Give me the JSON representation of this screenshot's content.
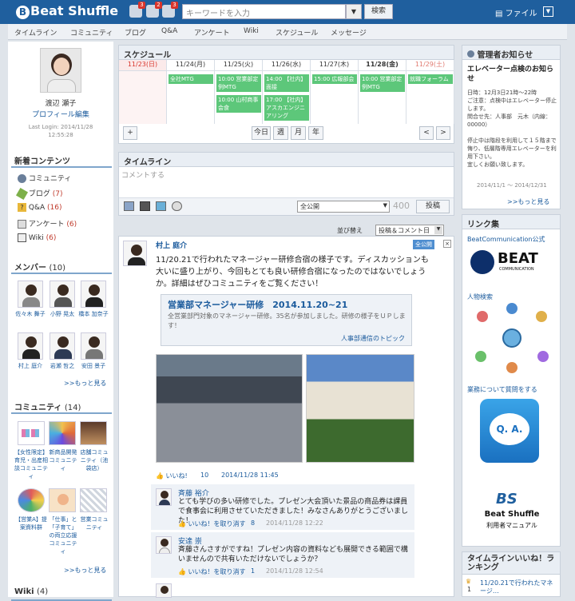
{
  "header": {
    "logo": "Beat Shuffle",
    "logo_b": "B",
    "logo_s": "S",
    "badges": [
      "3",
      "2",
      "3"
    ],
    "search_placeholder": "キーワードを入力",
    "search_button": "検索",
    "file_label": "ファイル"
  },
  "nav": [
    "タイムライン",
    "コミュニティ",
    "ブログ",
    "Q&A",
    "アンケート",
    "Wiki",
    "スケジュール",
    "メッセージ"
  ],
  "profile": {
    "name": "渡辺 瀬子",
    "edit": "プロフィール編集",
    "last_login": "Last Login: 2014/11/28",
    "last_time": "12:55:28"
  },
  "new_contents": {
    "title": "新着コンテンツ",
    "items": [
      {
        "label": "コミュニティ",
        "count": ""
      },
      {
        "label": "ブログ",
        "count": "(7)"
      },
      {
        "label": "Q&A",
        "count": "(16)"
      },
      {
        "label": "アンケート",
        "count": "(6)"
      },
      {
        "label": "Wiki",
        "count": "(6)"
      }
    ]
  },
  "members": {
    "title": "メンバー",
    "count": "(10)",
    "people": [
      "佐々木 舞子",
      "小野 晃太",
      "橋本 加奈子",
      "村上 庭介",
      "岩瀬 哲之",
      "安田 景子"
    ],
    "more": ">>もっと見る"
  },
  "community": {
    "title": "コミュニティ",
    "count": "(14)",
    "items": [
      "【女性限定】育児・出産相談コミュニティ",
      "新商品開発コミュニティ",
      "店舗コミュニティ（池袋店）",
      "【営業A】提案資料群",
      "「仕事」と「子育て」の両立応援コミュニティ",
      "営業コミュニティ"
    ],
    "more": ">>もっと見る"
  },
  "wiki": {
    "title": "Wiki",
    "count": "(4)"
  },
  "schedule": {
    "title": "スケジュール",
    "days": [
      "11/23(日)",
      "11/24(月)",
      "11/25(火)",
      "11/26(水)",
      "11/27(木)",
      "11/28(金)",
      "11/29(土)"
    ],
    "events": [
      {
        "d": 1,
        "text": "全社MTG"
      },
      {
        "d": 2,
        "text": "10:00 営業部定例MTG"
      },
      {
        "d": 2,
        "text": "10:00 山村商事会食"
      },
      {
        "d": 3,
        "text": "14:00 【社内】面接"
      },
      {
        "d": 3,
        "text": "17:00 【社内】アスカエンジニアリング"
      },
      {
        "d": 4,
        "text": "15:00 広報部会"
      },
      {
        "d": 5,
        "text": "10:00 営業部定例MTG"
      },
      {
        "d": 6,
        "text": "就職フォーラム"
      }
    ],
    "plus": "+",
    "today": "今日",
    "week": "週",
    "month": "月",
    "year": "年",
    "prev": "<",
    "next": ">"
  },
  "timeline": {
    "title": "タイムライン",
    "placeholder": "コメントする",
    "visibility": "全公開",
    "counter": "400",
    "post": "投稿",
    "sort_label": "並び替え",
    "sort_value": "投稿＆コメント日"
  },
  "post": {
    "author": "村上 庭介",
    "tag": "全公開",
    "text": "11/20.21で行われたマネージャー研修合宿の様子です。ディスカッションも大いに盛り上がり、今回もとても良い研修合宿になったのではないでしょうか。詳細はぜひコミュニティをご覧ください！",
    "link_title": "営業部マネージャー研修　2014.11.20~21",
    "link_desc": "全営業部門対象のマネージャー研修。35名が参加しました。研修の様子をＵＰします！",
    "link_source": "人事部通信のトピック",
    "likes_label": "いいね!",
    "likes": "10",
    "date": "2014/11/28 11:45"
  },
  "comments": [
    {
      "author": "斉藤 裕介",
      "text": "とても学びの多い研修でした。プレゼン大会頂いた景品の商品券は課員で食事会に利用させていただきました！みなさんありがとうございました！",
      "like": "いいね！を取り消す",
      "count": "8",
      "date": "2014/11/28 12:22"
    },
    {
      "author": "安達 崇",
      "text": "斉藤さんさすがですね！プレゼン内容の資料なども展開できる範囲で構いませんので共有いただけないでしょうか？",
      "like": "いいね！を取り消す",
      "count": "1",
      "date": "2014/11/28 12:54"
    }
  ],
  "notice": {
    "title": "管理者お知らせ",
    "headline": "エレベーター点検のお知らせ",
    "body": "日時：12月3日21時～22時\nご注意：点検中はエレベーター停止します。\n問合せ先：人事部　元木（内線：00000）\n\n停止中は階段を利用して１５階まで悔り、低層階専用エレベーターを利用下さい。\n宜しくお願い致します。",
    "period": "2014/11/1 ～ 2014/12/31",
    "more": ">>もっと見る"
  },
  "links": {
    "title": "リンク集",
    "items": [
      {
        "label": "BeatCommunication公式",
        "logo": "BEAT",
        "sub": "COMMUNICATION"
      },
      {
        "label": "人物検索"
      },
      {
        "label": "業務について質問をする",
        "qa": "Q. A."
      },
      {
        "bs": "BS",
        "bs1": "Beat Shuffle",
        "bs2": "利用者マニュアル"
      }
    ]
  },
  "ranking": {
    "title": "タイムラインいいね！ランキング",
    "first": "11/20.21で行われたマネージ…",
    "rank": "1"
  }
}
